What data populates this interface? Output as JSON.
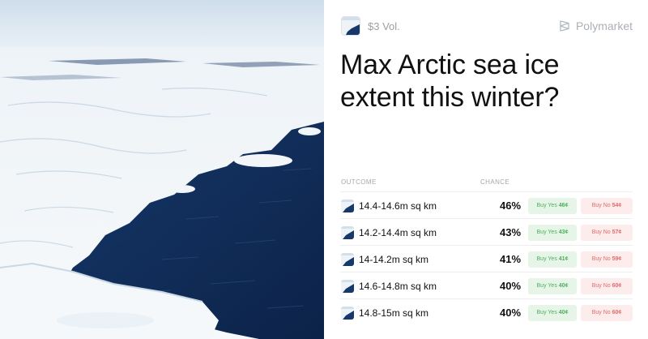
{
  "card": {
    "volume": "$3 Vol.",
    "brand": "Polymarket",
    "title": "Max Arctic sea ice extent this winter?",
    "headers": {
      "outcome": "OUTCOME",
      "chance": "CHANCE"
    },
    "outcomes": [
      {
        "label": "14.4-14.6m sq km",
        "chance": "46%",
        "buy_yes": "Buy Yes",
        "yes_price": "46¢",
        "buy_no": "Buy No",
        "no_price": "54¢"
      },
      {
        "label": "14.2-14.4m sq km",
        "chance": "43%",
        "buy_yes": "Buy Yes",
        "yes_price": "43¢",
        "buy_no": "Buy No",
        "no_price": "57¢"
      },
      {
        "label": "14-14.2m sq km",
        "chance": "41%",
        "buy_yes": "Buy Yes",
        "yes_price": "41¢",
        "buy_no": "Buy No",
        "no_price": "59¢"
      },
      {
        "label": "14.6-14.8m sq km",
        "chance": "40%",
        "buy_yes": "Buy Yes",
        "yes_price": "40¢",
        "buy_no": "Buy No",
        "no_price": "60¢"
      },
      {
        "label": "14.8-15m sq km",
        "chance": "40%",
        "buy_yes": "Buy Yes",
        "yes_price": "40¢",
        "buy_no": "Buy No",
        "no_price": "60¢"
      }
    ]
  },
  "colors": {
    "yes_bg": "#e6f5e8",
    "yes_text": "#4fae5d",
    "no_bg": "#fdecec",
    "no_text": "#e46a6a",
    "sea": "#0f2a55",
    "ice": "#f3f6f9",
    "sky": "#dce8f2"
  },
  "icons": {
    "market": "sea-ice-thumbnail-icon",
    "brand": "polymarket-logo-icon"
  }
}
